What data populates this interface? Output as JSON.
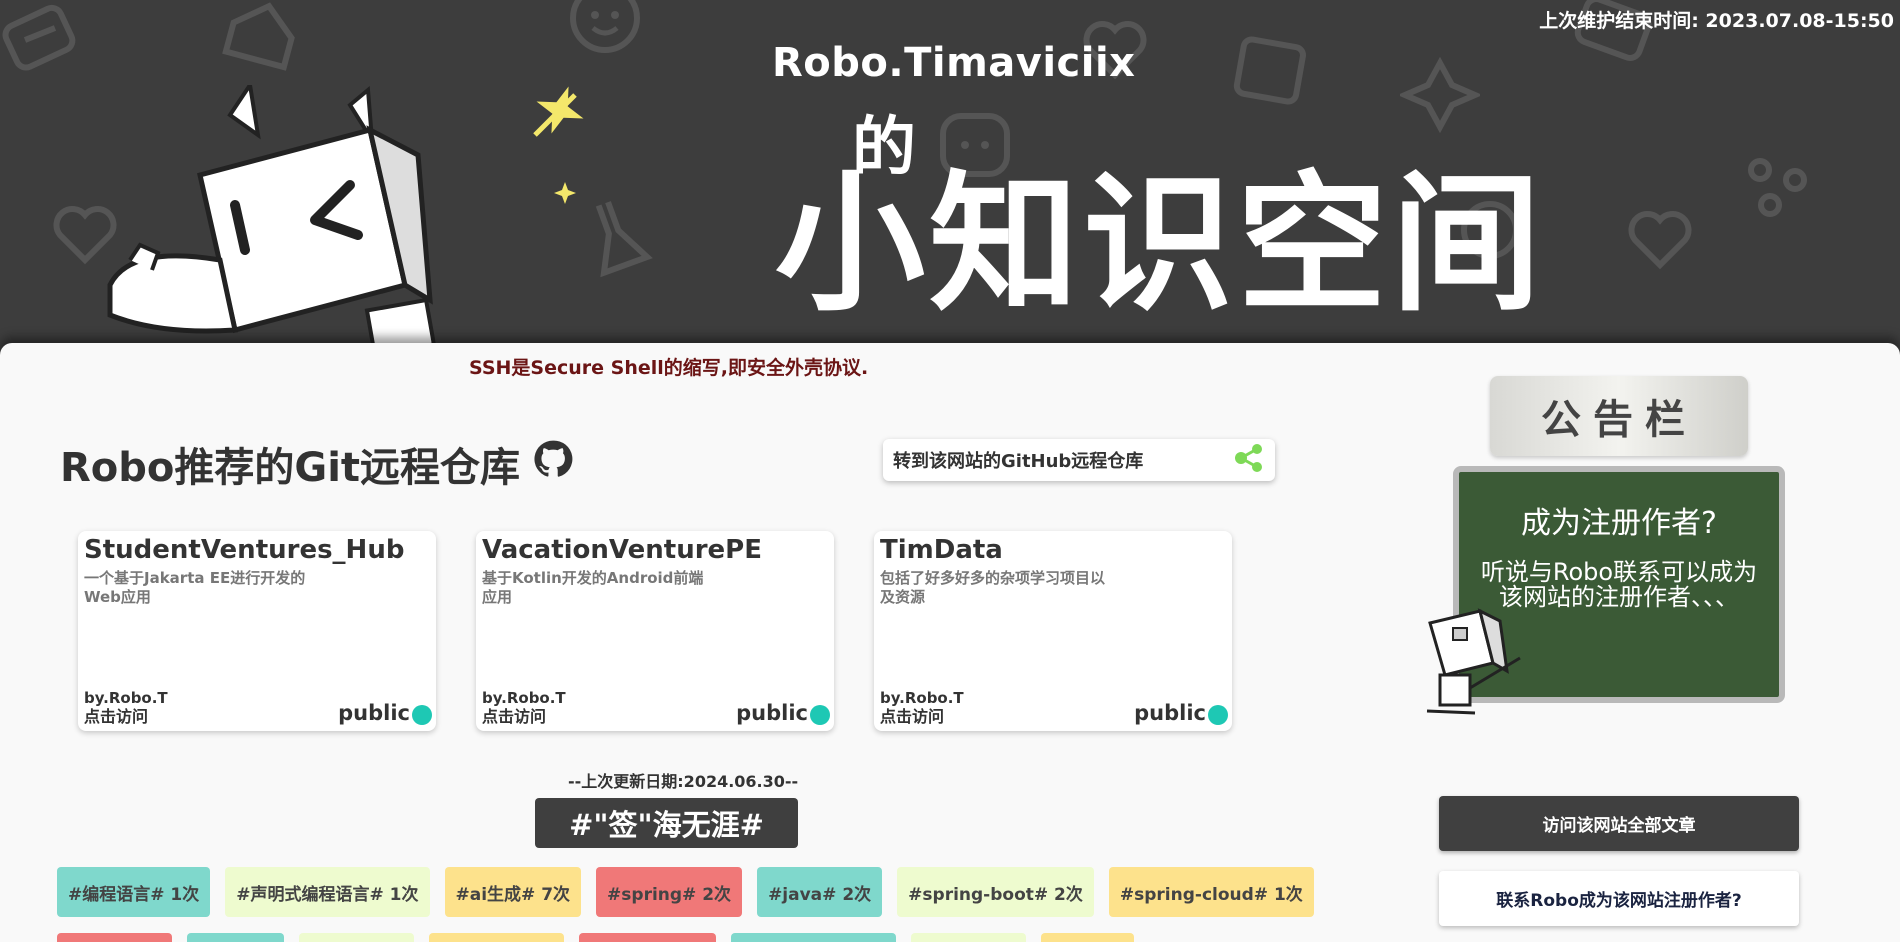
{
  "header": {
    "maintenance_text": "上次维护结束时间: 2023.07.08-15:50",
    "brand_en": "Robo.Timaviciix",
    "brand_de": "的",
    "brand_big": "小知识空间"
  },
  "tip": "SSH是Secure Shell的缩写,即安全外壳协议.",
  "repos": {
    "title": "Robo推荐的Git远程仓库",
    "goto_label": "转到该网站的GitHub远程仓库",
    "items": [
      {
        "name": "StudentVentures_Hub",
        "desc": "一个基于Jakarta EE进行开发的Web应用",
        "by": "by.Robo.T",
        "visit": "点击访问",
        "visibility": "public"
      },
      {
        "name": "VacationVenturePE",
        "desc": "基于Kotlin开发的Android前端应用",
        "by": "by.Robo.T",
        "visit": "点击访问",
        "visibility": "public"
      },
      {
        "name": "TimData",
        "desc": "包括了好多好多的杂项学习项目以及资源",
        "by": "by.Robo.T",
        "visit": "点击访问",
        "visibility": "public"
      }
    ]
  },
  "updated": "--上次更新日期:2024.06.30--",
  "tag_sea": "#\"签\"海无涯#",
  "tags": [
    {
      "label": "#编程语言# 1次",
      "color": "#7fd8cc"
    },
    {
      "label": "#声明式编程语言# 1次",
      "color": "#eefbcf"
    },
    {
      "label": "#ai生成# 7次",
      "color": "#fde28c"
    },
    {
      "label": "#spring# 2次",
      "color": "#f07878"
    },
    {
      "label": "#java# 2次",
      "color": "#7fd8cc"
    },
    {
      "label": "#spring-boot# 2次",
      "color": "#eefbcf"
    },
    {
      "label": "#spring-cloud# 1次",
      "color": "#fde28c"
    }
  ],
  "notice": {
    "title": "公告栏",
    "question": "成为注册作者?",
    "message": "听说与Robo联系可以成为该网站的注册作者、、、"
  },
  "buttons": {
    "all_articles": "访问该网站全部文章",
    "contact": "联系Robo成为该网站注册作者?"
  }
}
